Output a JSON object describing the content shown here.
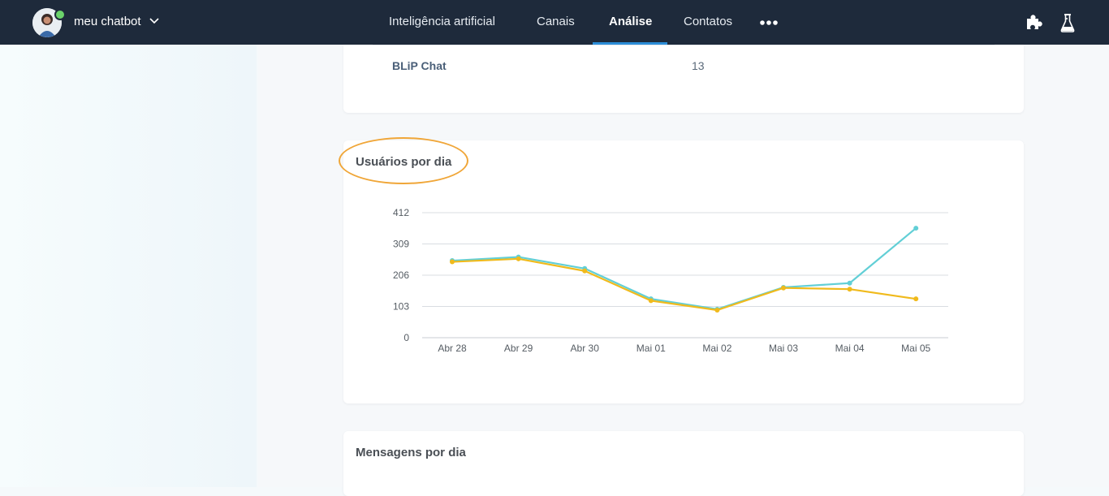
{
  "header": {
    "bot_name": "meu chatbot",
    "nav": [
      {
        "label": "Inteligência artificial",
        "active": false
      },
      {
        "label": "Canais",
        "active": false
      },
      {
        "label": "Análise",
        "active": true
      },
      {
        "label": "Contatos",
        "active": false
      }
    ],
    "more_icon": "more-horizontal-icon",
    "extensions_icon": "puzzle-icon",
    "labs_icon": "flask-icon",
    "accent_color": "#2d8ed8",
    "bar_color": "#1e2a3b"
  },
  "channels_table": {
    "rows": [
      {
        "channel": "BLiP Chat",
        "value": "13"
      }
    ]
  },
  "users_card": {
    "title": "Usuários por dia"
  },
  "chart_data": {
    "type": "line",
    "title": "Usuários por dia",
    "categories": [
      "Abr 28",
      "Abr 29",
      "Abr 30",
      "Mai 01",
      "Mai 02",
      "Mai 03",
      "Mai 04",
      "Mai 05"
    ],
    "y_ticks": [
      "0",
      "103",
      "206",
      "309",
      "412"
    ],
    "ylim": [
      0,
      412
    ],
    "grid": true,
    "series": [
      {
        "color": "#62cfd6",
        "values": [
          254,
          266,
          228,
          128,
          94,
          166,
          180,
          361
        ]
      },
      {
        "color": "#f0ba1c",
        "values": [
          250,
          260,
          220,
          122,
          91,
          164,
          160,
          128
        ]
      }
    ]
  },
  "messages_card": {
    "title": "Mensagens por dia"
  }
}
